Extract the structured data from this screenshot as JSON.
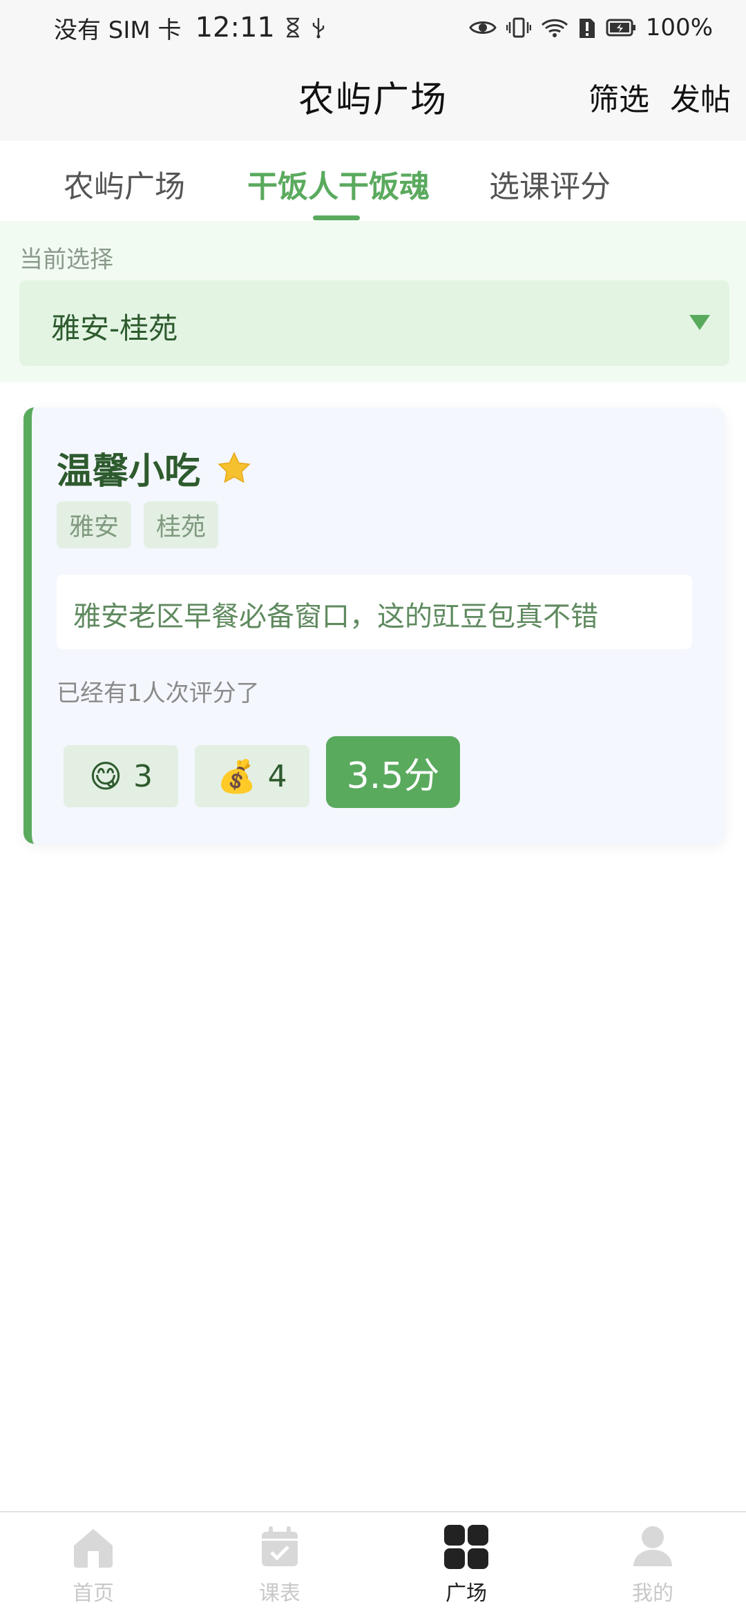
{
  "status_bar": {
    "carrier": "没有 SIM 卡",
    "time": "12:11",
    "battery": "100%"
  },
  "header": {
    "title": "农屿广场",
    "filter_label": "筛选",
    "post_label": "发帖"
  },
  "tabs": [
    {
      "label": "农屿广场",
      "active": false
    },
    {
      "label": "干饭人干饭魂",
      "active": true
    },
    {
      "label": "选课评分",
      "active": false
    }
  ],
  "selection": {
    "label": "当前选择",
    "value": "雅安-桂苑"
  },
  "card": {
    "title": "温馨小吃",
    "favorite_icon": "star-icon",
    "tags": [
      "雅安",
      "桂苑"
    ],
    "description": "雅安老区早餐必备窗口，这的豇豆包真不错",
    "rating_count_text": "已经有1人次评分了",
    "taste_emoji": "😋",
    "taste_score": "3",
    "price_emoji": "💰",
    "price_score": "4",
    "total_score": "3.5分"
  },
  "bottom_nav": [
    {
      "label": "首页",
      "icon": "home-icon",
      "active": false
    },
    {
      "label": "课表",
      "icon": "calendar-check-icon",
      "active": false
    },
    {
      "label": "广场",
      "icon": "grid-icon",
      "active": true
    },
    {
      "label": "我的",
      "icon": "person-icon",
      "active": false
    }
  ],
  "colors": {
    "accent": "#5aaa5e",
    "dark_green": "#2e5b2e",
    "panel_bg": "#f2fbf2"
  }
}
